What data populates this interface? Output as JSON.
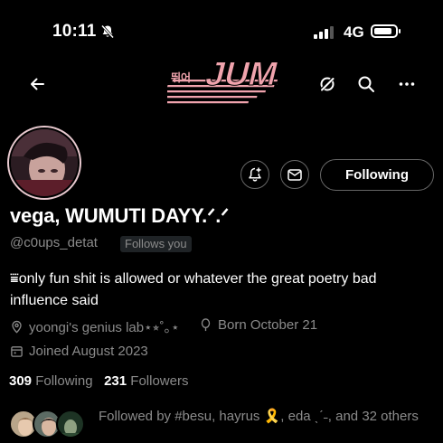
{
  "status_bar": {
    "time": "10:11",
    "network": "4G",
    "battery_level": 0.85,
    "signal_bars_filled": 3,
    "signal_bars_total": 4
  },
  "header": {
    "banner_text": "JUMP",
    "banner_subtext": "뛰어"
  },
  "profile": {
    "display_name": "vega, WUMUTI DAYY.ᐟ.ᐟ",
    "handle": "@c0ups_detat",
    "follows_you_badge": "Follows you",
    "bio": "⩸only fun shit is allowed or whatever the great poetry bad influence said",
    "location": "yoongi's genius lab⋆⭒˚｡⋆",
    "birthday": "Born October 21",
    "joined": "Joined August 2023",
    "following_count": "309",
    "following_label": "Following",
    "followers_count": "231",
    "followers_label": "Followers",
    "followed_by": "Followed by #besu, hayrus 🎗️, eda ˎˊ˗, and 32 others"
  },
  "actions": {
    "following_button": "Following"
  },
  "colors": {
    "background": "#000000",
    "secondary_text": "#8b8b8b",
    "button_border": "#666666",
    "banner_pink": "#f0a3ad"
  }
}
